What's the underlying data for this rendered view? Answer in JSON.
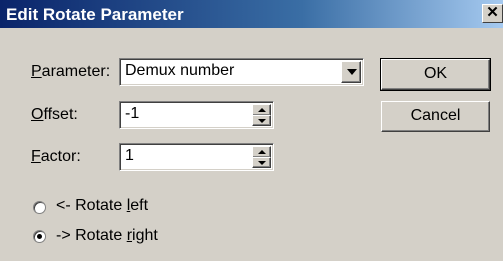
{
  "window": {
    "title": "Edit Rotate Parameter",
    "close_glyph": "✕"
  },
  "parameter": {
    "label_mnemonic": "P",
    "label_rest": "arameter:",
    "value": "Demux number"
  },
  "offset": {
    "label_mnemonic": "O",
    "label_rest": "ffset:",
    "value": "-1"
  },
  "factor": {
    "label_mnemonic": "F",
    "label_rest": "actor:",
    "value": "1"
  },
  "buttons": {
    "ok": "OK",
    "cancel": "Cancel"
  },
  "rotate_left": {
    "label_prefix": "<- Rotate ",
    "label_mnemonic": "l",
    "label_rest": "eft",
    "selected": false
  },
  "rotate_right": {
    "label_prefix": "-> Rotate ",
    "label_mnemonic": "r",
    "label_rest": "ight",
    "selected": true
  }
}
